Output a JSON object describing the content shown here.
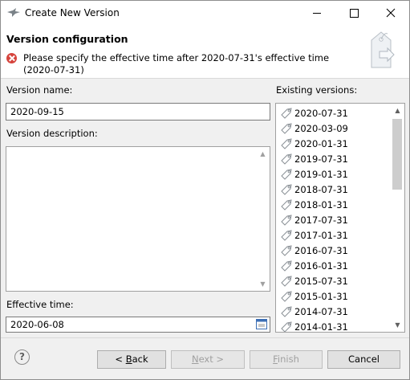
{
  "window": {
    "title": "Create New Version"
  },
  "banner": {
    "title": "Version configuration",
    "message": "Please specify the effective time after 2020-07-31's effective time (2020-07-31)"
  },
  "form": {
    "version_name_label": "Version name:",
    "version_name_value": "2020-09-15",
    "description_label": "Version description:",
    "description_value": "",
    "effective_time_label": "Effective time:",
    "effective_time_value": "2020-06-08"
  },
  "existing": {
    "label": "Existing versions:",
    "items": [
      "2020-07-31",
      "2020-03-09",
      "2020-01-31",
      "2019-07-31",
      "2019-01-31",
      "2018-07-31",
      "2018-01-31",
      "2017-07-31",
      "2017-01-31",
      "2016-07-31",
      "2016-01-31",
      "2015-07-31",
      "2015-01-31",
      "2014-07-31",
      "2014-01-31"
    ],
    "item_icon": "tag-icon"
  },
  "buttons": {
    "back_prefix": "< ",
    "back_mnemonic": "B",
    "back_rest": "ack",
    "next_mnemonic": "N",
    "next_rest": "ext >",
    "finish_mnemonic": "F",
    "finish_rest": "inish",
    "cancel": "Cancel"
  },
  "help": {
    "glyph": "?"
  },
  "colors": {
    "error": "#d6443d",
    "list_thumb": "#cdcdcd",
    "disabled_text": "#a0a0a0"
  }
}
